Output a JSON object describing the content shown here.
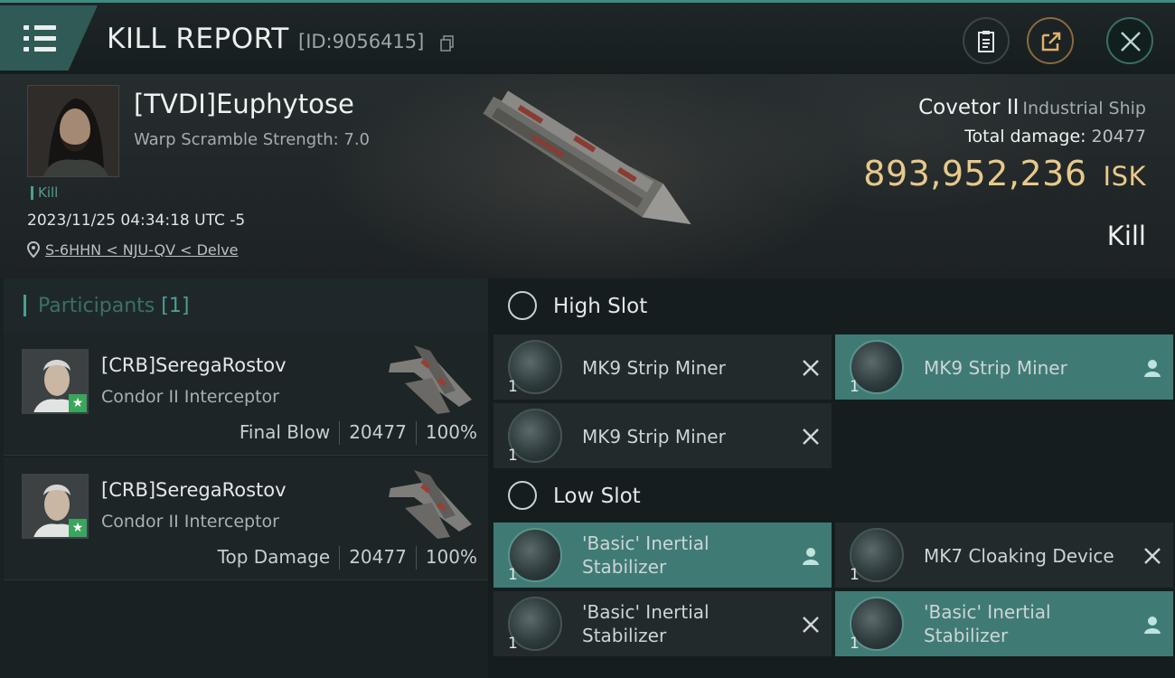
{
  "header": {
    "title": "KILL REPORT",
    "report_id": "[ID:9056415]"
  },
  "victim": {
    "name": "[TVDI]Euphytose",
    "warp_scramble": "Warp Scramble Strength: 7.0",
    "tag": "Kill",
    "datetime": "2023/11/25 04:34:18 UTC -5",
    "location": "S-6HHN < NJU-QV < Delve"
  },
  "ship": {
    "name": "Covetor II",
    "class": "Industrial Ship",
    "total_damage_label": "Total damage:",
    "total_damage": "20477",
    "value": "893,952,236",
    "unit": "ISK",
    "result": "Kill"
  },
  "participants": {
    "title": "Participants",
    "count": "[1]",
    "items": [
      {
        "name": "[CRB]SeregaRostov",
        "ship": "Condor II Interceptor",
        "role": "Final Blow",
        "damage": "20477",
        "percent": "100%"
      },
      {
        "name": "[CRB]SeregaRostov",
        "ship": "Condor II Interceptor",
        "role": "Top Damage",
        "damage": "20477",
        "percent": "100%"
      }
    ]
  },
  "fitting": {
    "high_slot_label": "High Slot",
    "low_slot_label": "Low Slot",
    "high": [
      {
        "name": "MK9 Strip Miner",
        "qty": "1",
        "status": "destroyed"
      },
      {
        "name": "MK9 Strip Miner",
        "qty": "1",
        "status": "dropped"
      },
      {
        "name": "MK9 Strip Miner",
        "qty": "1",
        "status": "destroyed"
      }
    ],
    "low": [
      {
        "name": "'Basic' Inertial Stabilizer",
        "qty": "1",
        "status": "dropped"
      },
      {
        "name": "MK7 Cloaking Device",
        "qty": "1",
        "status": "destroyed"
      },
      {
        "name": "'Basic' Inertial Stabilizer",
        "qty": "1",
        "status": "destroyed"
      },
      {
        "name": "'Basic' Inertial Stabilizer",
        "qty": "1",
        "status": "dropped"
      }
    ]
  },
  "colors": {
    "accent": "#4e9d92",
    "isk": "#e8c98a",
    "dropped_bg": "#3f7b74"
  }
}
